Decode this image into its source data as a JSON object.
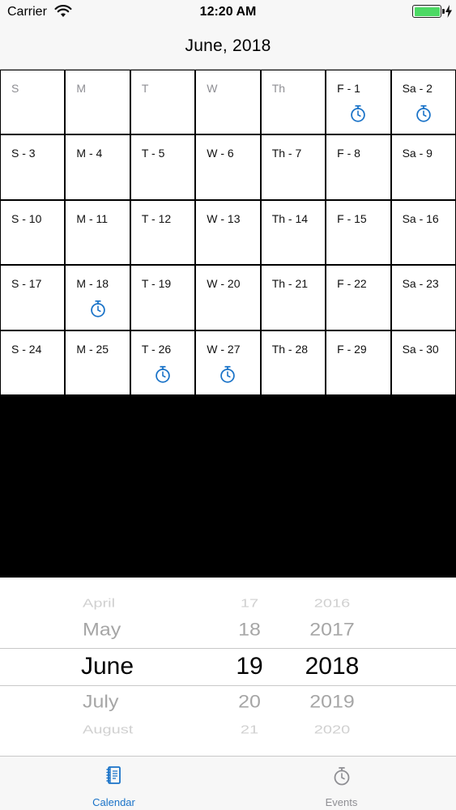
{
  "status_bar": {
    "carrier": "Carrier",
    "time": "12:20 AM",
    "battery_percent": 100
  },
  "nav": {
    "title": "June, 2018"
  },
  "calendar": {
    "header": [
      "S",
      "M",
      "T",
      "W",
      "Th",
      "F - 1",
      "Sa - 2"
    ],
    "weeks": [
      [
        "S - 3",
        "M - 4",
        "T - 5",
        "W - 6",
        "Th - 7",
        "F - 8",
        "Sa - 9"
      ],
      [
        "S - 10",
        "M - 11",
        "T - 12",
        "W - 13",
        "Th - 14",
        "F - 15",
        "Sa - 16"
      ],
      [
        "S - 17",
        "M - 18",
        "T - 19",
        "W - 20",
        "Th - 21",
        "F - 22",
        "Sa - 23"
      ],
      [
        "S - 24",
        "M - 25",
        "T - 26",
        "W - 27",
        "Th - 28",
        "F - 29",
        "Sa - 30"
      ]
    ],
    "event_icon": "stopwatch-icon",
    "event_days": [
      "F - 1",
      "Sa - 2",
      "M - 18",
      "T - 26",
      "W - 27"
    ],
    "accent_color": "#1a73c8"
  },
  "picker": {
    "months": [
      "April",
      "May",
      "June",
      "July",
      "August"
    ],
    "days": [
      "17",
      "18",
      "19",
      "20",
      "21"
    ],
    "years": [
      "2016",
      "2017",
      "2018",
      "2019",
      "2020"
    ]
  },
  "tab_bar": {
    "tabs": [
      {
        "label": "Calendar",
        "icon": "calendar-book-icon",
        "selected": true
      },
      {
        "label": "Events",
        "icon": "stopwatch-icon",
        "selected": false
      }
    ]
  }
}
